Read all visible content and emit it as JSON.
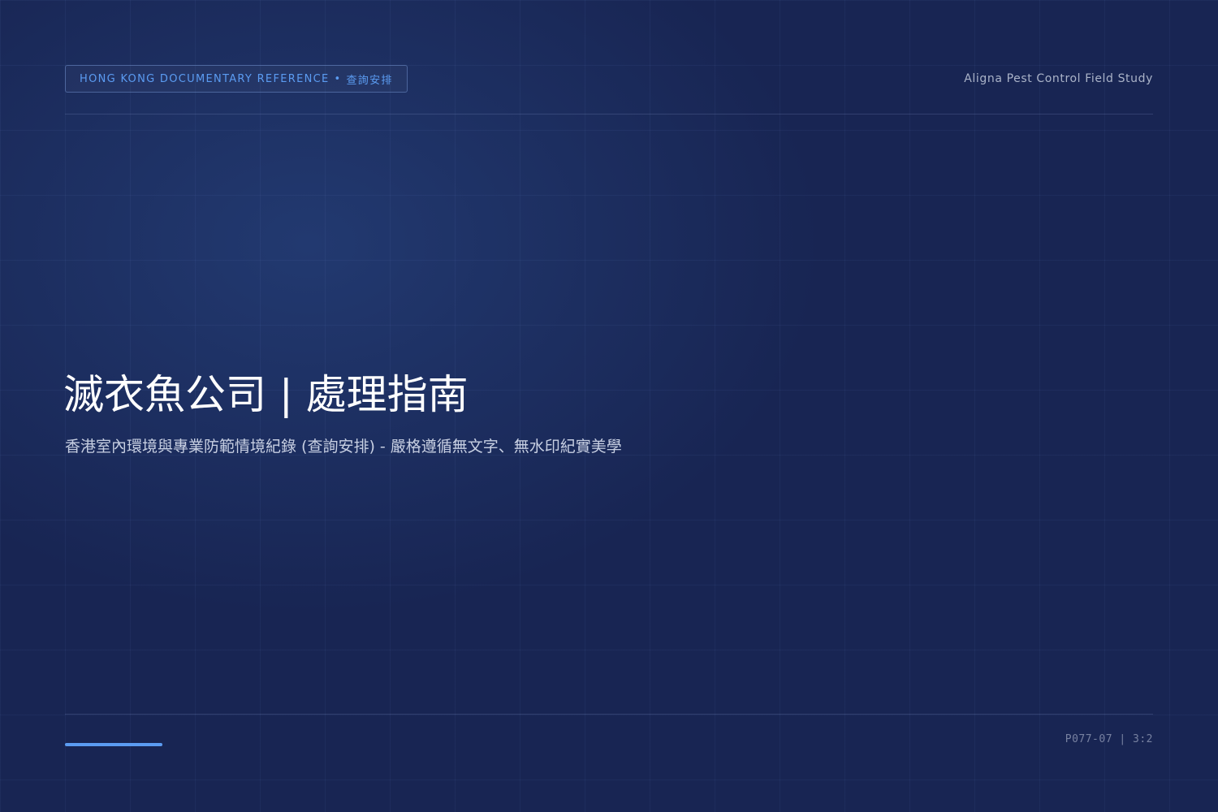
{
  "header": {
    "badge": {
      "text": "HONG KONG DOCUMENTARY REFERENCE",
      "separator": "•",
      "tag": "查詢安排"
    },
    "study_label": "Aligna Pest Control Field Study"
  },
  "main": {
    "title": "滅衣魚公司 | 處理指南",
    "subtitle": "香港室內環境與專業防範情境紀錄 (查詢安排) - 嚴格遵循無文字、無水印紀實美學"
  },
  "footer": {
    "page_code": "P077-07 | 3:2"
  },
  "colors": {
    "background": "#182553",
    "accent": "#5b9cf2",
    "title_text": "#ffffff",
    "subtitle_text": "#c7cfe2",
    "muted_text": "#7781a0"
  }
}
